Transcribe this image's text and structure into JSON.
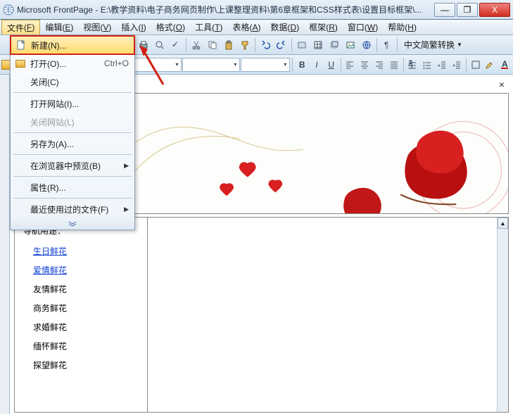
{
  "title": "Microsoft FrontPage - E:\\教学资料\\电子商务网页制作\\上课整理资料\\第6章框架和CSS样式表\\设置目标框架\\...",
  "window_controls": {
    "min": "—",
    "max": "❐",
    "close": "X"
  },
  "menubar": [
    {
      "label": "文件",
      "accel": "F",
      "active": true
    },
    {
      "label": "编辑",
      "accel": "E"
    },
    {
      "label": "视图",
      "accel": "V"
    },
    {
      "label": "插入",
      "accel": "I"
    },
    {
      "label": "格式",
      "accel": "O"
    },
    {
      "label": "工具",
      "accel": "T"
    },
    {
      "label": "表格",
      "accel": "A"
    },
    {
      "label": "数据",
      "accel": "D"
    },
    {
      "label": "框架",
      "accel": "R"
    },
    {
      "label": "窗口",
      "accel": "W"
    },
    {
      "label": "帮助",
      "accel": "H"
    }
  ],
  "dropdown": {
    "new": {
      "label": "新建(N)...",
      "highlighted": true
    },
    "open": {
      "label": "打开(O)...",
      "shortcut": "Ctrl+O"
    },
    "close": {
      "label": "关闭(C)"
    },
    "open_site": {
      "label": "打开网站(I)..."
    },
    "close_site": {
      "label": "关闭网站(L)",
      "disabled": true
    },
    "save_as": {
      "label": "另存为(A)..."
    },
    "preview": {
      "label": "在浏览器中预览(B)"
    },
    "props": {
      "label": "属性(R)..."
    },
    "recent": {
      "label": "最近使用过的文件(F)"
    }
  },
  "toolbar2": {
    "cn_convert": "中文简繁转换"
  },
  "format_buttons": {
    "bold": "B",
    "italic": "I",
    "underline": "U"
  },
  "nav": {
    "title": "导航用途：",
    "links": [
      "生日鲜花",
      "爱情鲜花"
    ],
    "texts": [
      "友情鲜花",
      "商务鲜花",
      "求婚鲜花",
      "缅怀鲜花",
      "探望鲜花"
    ]
  }
}
